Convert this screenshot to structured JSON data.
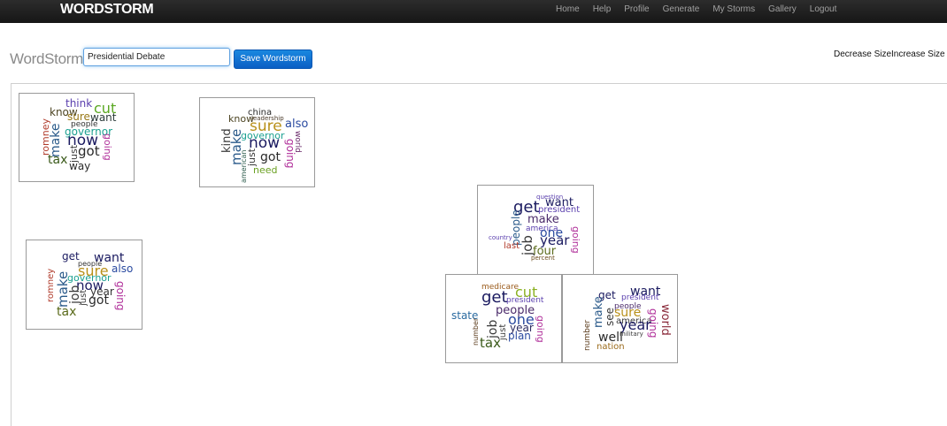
{
  "nav": {
    "brand": "WORDSTORM",
    "links": [
      "Home",
      "Help",
      "Profile",
      "Generate",
      "My Storms",
      "Gallery",
      "Logout"
    ]
  },
  "header": {
    "title": "WordStorm:",
    "storm_name_value": "Presidential Debate",
    "save_label": "Save Wordstorm",
    "decrease_label": "Decrease Size",
    "increase_label": "Increase Size"
  },
  "clouds": [
    {
      "words": [
        "think",
        "cut",
        "know",
        "sure",
        "want",
        "people",
        "make",
        "governor",
        "now",
        "romney",
        "going",
        "got",
        "just",
        "tax",
        "way"
      ]
    },
    {
      "words": [
        "china",
        "know",
        "leadership",
        "sure",
        "also",
        "governor",
        "world",
        "kind",
        "make",
        "now",
        "going",
        "just",
        "got",
        "american",
        "need"
      ]
    },
    {
      "words": [
        "get",
        "want",
        "people",
        "sure",
        "also",
        "governor",
        "make",
        "romney",
        "now",
        "year",
        "going",
        "job",
        "just",
        "got",
        "tax"
      ]
    },
    {
      "words": [
        "question",
        "get",
        "want",
        "president",
        "people",
        "make",
        "america",
        "one",
        "going",
        "country",
        "year",
        "job",
        "last",
        "four",
        "percent"
      ]
    },
    {
      "words": [
        "medicare",
        "cut",
        "get",
        "president",
        "people",
        "state",
        "one",
        "going",
        "job",
        "just",
        "year",
        "plan",
        "number",
        "tax"
      ]
    },
    {
      "words": [
        "get",
        "want",
        "president",
        "people",
        "make",
        "see",
        "sure",
        "america",
        "world",
        "going",
        "year",
        "number",
        "well",
        "military",
        "nation"
      ]
    }
  ],
  "colors": {
    "navbar": "#1f1f1f",
    "accent": "#0b6fd0"
  }
}
